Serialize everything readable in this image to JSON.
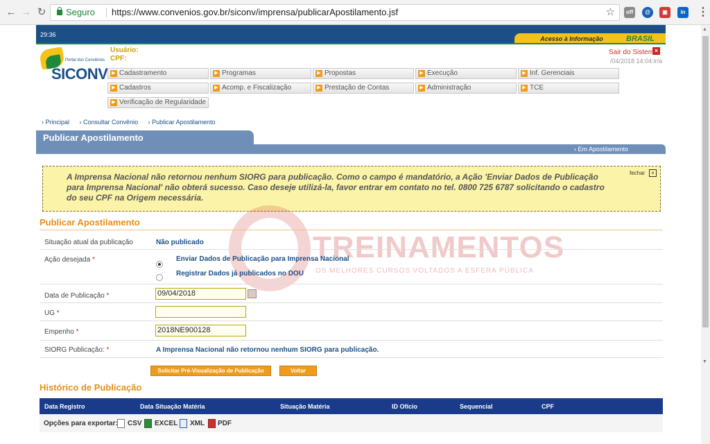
{
  "browser": {
    "secure_label": "Seguro",
    "url": "https://www.convenios.gov.br/siconv/imprensa/publicarApostilamento.jsf"
  },
  "header": {
    "clock": "29:36",
    "acesso_informacao": "Acesso à Informação",
    "brasil": "BRASIL",
    "logo_sub": "Portal dos Convênios",
    "logo_text": "SICONV",
    "usuario_label": "Usuário:",
    "cpf_label": "CPF:",
    "sair": "Sair do Sistema",
    "datetime": "/04/2018 14:04:ir/a"
  },
  "menu": {
    "row1": [
      "Cadastramento",
      "Programas",
      "Propostas",
      "Execução",
      "Inf. Gerenciais"
    ],
    "row2": [
      "Cadastros",
      "Acomp. e Fiscalização",
      "Prestação de Contas",
      "Administração",
      "TCE"
    ],
    "row3": [
      "Verificação de Regularidade"
    ]
  },
  "breadcrumb": [
    "Principal",
    "Consultar Convênio",
    "Publicar Apostilamento"
  ],
  "page": {
    "tab_title": "Publicar Apostilamento",
    "strip_label": "Em Apostilamento"
  },
  "alert": {
    "message": "A Imprensa Nacional não retornou nenhum SIORG para publicação. Como o campo é mandatório, a Ação 'Enviar Dados de Publicação para Imprensa Nacional' não obterá sucesso. Caso deseje utilizá-la, favor entrar em contato no tel. 0800 725 6787 solicitando o cadastro do seu CPF na Origem necessária.",
    "close_label": "fechar"
  },
  "form": {
    "section_title": "Publicar Apostilamento",
    "situacao_label": "Situação atual da publicação",
    "situacao_value": "Não publicado",
    "acao_label": "Ação desejada",
    "acao_options": [
      "Enviar Dados de Publicação para Imprensa Nacional",
      "Registrar Dados já publicados no DOU"
    ],
    "data_label": "Data de Publicação",
    "data_value": "09/04/2018",
    "ug_label": "UG",
    "ug_value": "",
    "empenho_label": "Empenho",
    "empenho_value": "2018NE900128",
    "siorg_label": "SIORG Publicação:",
    "siorg_value": "A Imprensa Nacional não retornou nenhum SIORG para publicação.",
    "required_mark": "*"
  },
  "buttons": {
    "preview": "Solicitar Pré-Visualização de Publicação",
    "voltar": "Voltar"
  },
  "history": {
    "title": "Histórico de Publicação",
    "columns": [
      "Data Registro",
      "Data Situação Matéria",
      "Situação Matéria",
      "ID Ofício",
      "Sequencial",
      "CPF"
    ],
    "export_label": "Opções para exportar:",
    "export_options": [
      "CSV",
      "EXCEL",
      "XML",
      "PDF"
    ]
  },
  "watermark": {
    "title": "TREINAMENTOS",
    "subtitle": "OS MELHORES CURSOS VOLTADOS A ESFERA PÚBLICA"
  }
}
